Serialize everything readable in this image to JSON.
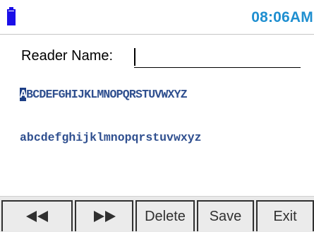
{
  "status": {
    "time": "08:06AM",
    "battery_icon": "battery-full-icon",
    "accent_color": "#1f8fd0",
    "battery_color": "#1b0fe8"
  },
  "form": {
    "label": "Reader Name:",
    "value": "",
    "placeholder": ""
  },
  "keyboard": {
    "selected_key": "A",
    "uppercase": [
      "A",
      "B",
      "C",
      "D",
      "E",
      "F",
      "G",
      "H",
      "I",
      "J",
      "K",
      "L",
      "M",
      "N",
      "O",
      "P",
      "Q",
      "R",
      "S",
      "T",
      "U",
      "V",
      "W",
      "X",
      "Y",
      "Z"
    ],
    "lowercase": [
      "a",
      "b",
      "c",
      "d",
      "e",
      "f",
      "g",
      "h",
      "i",
      "j",
      "k",
      "l",
      "m",
      "n",
      "o",
      "p",
      "q",
      "r",
      "s",
      "t",
      "u",
      "v",
      "w",
      "x",
      "y",
      "z"
    ],
    "text_color": "#2f4f8f",
    "highlight_color": "#1d3f86"
  },
  "buttons": {
    "prev_icon": "rewind-icon",
    "next_icon": "fast-forward-icon",
    "delete_label": "Delete",
    "save_label": "Save",
    "exit_label": "Exit"
  }
}
